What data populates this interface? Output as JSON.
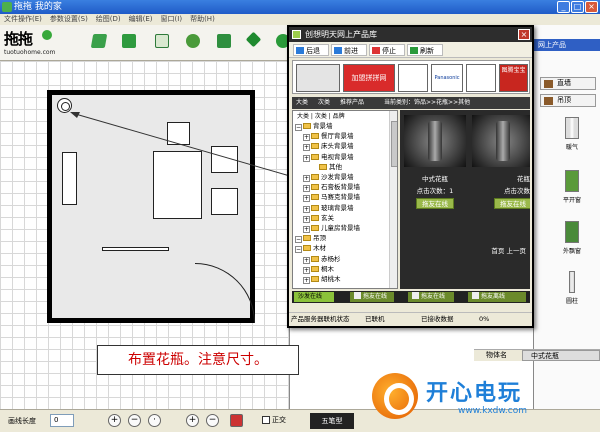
{
  "main_window": {
    "title": "拖拖 我的家",
    "menu": [
      "文件操作(E)",
      "参数设置(S)",
      "绘图(D)",
      "编辑(E)",
      "窗口(I)",
      "帮助(H)"
    ]
  },
  "brand": {
    "logo_text": "拖拖",
    "url": "tuotuohome.com"
  },
  "canvas": {
    "caption": "布置花瓶。注意尺寸。"
  },
  "status_bar": {
    "label": "画线长度",
    "value": "0",
    "checkbox_label": "正交"
  },
  "ime_label": "五笔型",
  "right_panel": {
    "title": "网上产品",
    "buttons": [
      "直墙",
      "吊顶"
    ],
    "items": [
      "暖气",
      "平开窗",
      "外飘窗",
      "圆柱"
    ],
    "prop_key": "物体名",
    "prop_value": "中式花瓶"
  },
  "product_window": {
    "title": "创想明天网上产品库",
    "nav": [
      "后退",
      "前进",
      "停止",
      "刷新"
    ],
    "ads": [
      "加盟拼拼网",
      "Panasonic",
      "图腾宝宝"
    ],
    "tabs": [
      "大类",
      "次类",
      "推荐产品",
      "当前类别：饰品>>花瓶>>其他"
    ],
    "tree_header": "大类 | 次类 | 品牌",
    "tree": [
      {
        "label": "背景墙",
        "level": 1
      },
      {
        "label": "餐厅背景墙",
        "level": 2
      },
      {
        "label": "床头背景墙",
        "level": 2
      },
      {
        "label": "电视背景墙",
        "level": 2
      },
      {
        "label": "其他",
        "level": 3
      },
      {
        "label": "沙发背景墙",
        "level": 2
      },
      {
        "label": "石膏板背景墙",
        "level": 2
      },
      {
        "label": "马赛克背景墙",
        "level": 2
      },
      {
        "label": "玻璃背景墙",
        "level": 2
      },
      {
        "label": "玄关",
        "level": 2
      },
      {
        "label": "儿童房背景墙",
        "level": 2
      },
      {
        "label": "吊顶",
        "level": 1
      },
      {
        "label": "木材",
        "level": 1
      },
      {
        "label": "赤杨杉",
        "level": 2
      },
      {
        "label": "桐木",
        "level": 2
      },
      {
        "label": "胡桃木",
        "level": 2
      }
    ],
    "products": [
      {
        "name": "中式花瓶",
        "clicks": "点击次数：1",
        "button": "拖友在线"
      },
      {
        "name": "花瓶",
        "clicks": "点击次数",
        "button": "拖友在线"
      }
    ],
    "pager": "首页  上一页",
    "users": [
      "沙发在线",
      "拖友在线",
      "拖友在线",
      "拖友离线"
    ],
    "status": {
      "label": "产品服务器联机状态",
      "state": "已联机",
      "data": "已接收数据",
      "progress": "0%"
    }
  },
  "watermark": {
    "title": "开心电玩",
    "url": "www.kxdw.com"
  }
}
